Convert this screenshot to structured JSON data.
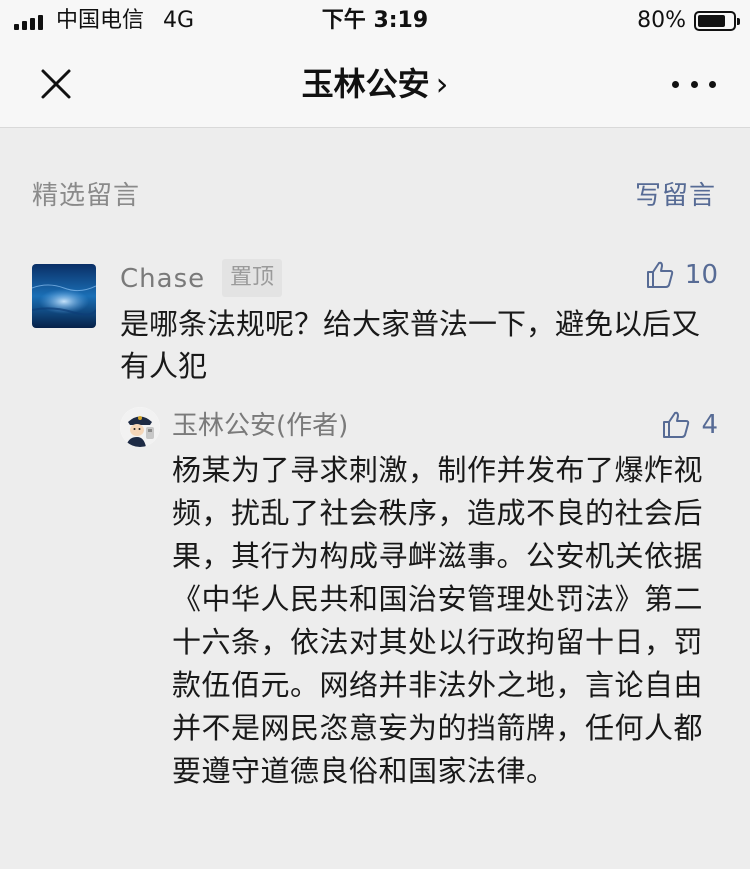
{
  "status_bar": {
    "carrier": "中国电信",
    "network": "4G",
    "time": "下午 3:19",
    "battery_percent": "80%",
    "battery_level": 0.8
  },
  "nav": {
    "title": "玉林公安",
    "title_chevron": "›",
    "close_icon": "close-icon",
    "more_icon": "more-icon"
  },
  "section": {
    "label": "精选留言",
    "write_label": "写留言"
  },
  "comment": {
    "author": "Chase",
    "pin_label": "置顶",
    "likes": "10",
    "text": "是哪条法规呢？给大家普法一下，避免以后又有人犯",
    "reply": {
      "author": "玉林公安(作者)",
      "likes": "4",
      "text": "杨某为了寻求刺激，制作并发布了爆炸视频，扰乱了社会秩序，造成不良的社会后果，其行为构成寻衅滋事。公安机关依据《中华人民共和国治安管理处罚法》第二十六条，依法对其处以行政拘留十日，罚款伍佰元。网络并非法外之地，言论自由并不是网民恣意妄为的挡箭牌，任何人都要遵守道德良俗和国家法律。"
    }
  },
  "colors": {
    "link": "#576b95",
    "background": "#ededed",
    "nav_background": "#f7f7f7",
    "secondary_text": "#7a7a7a"
  }
}
